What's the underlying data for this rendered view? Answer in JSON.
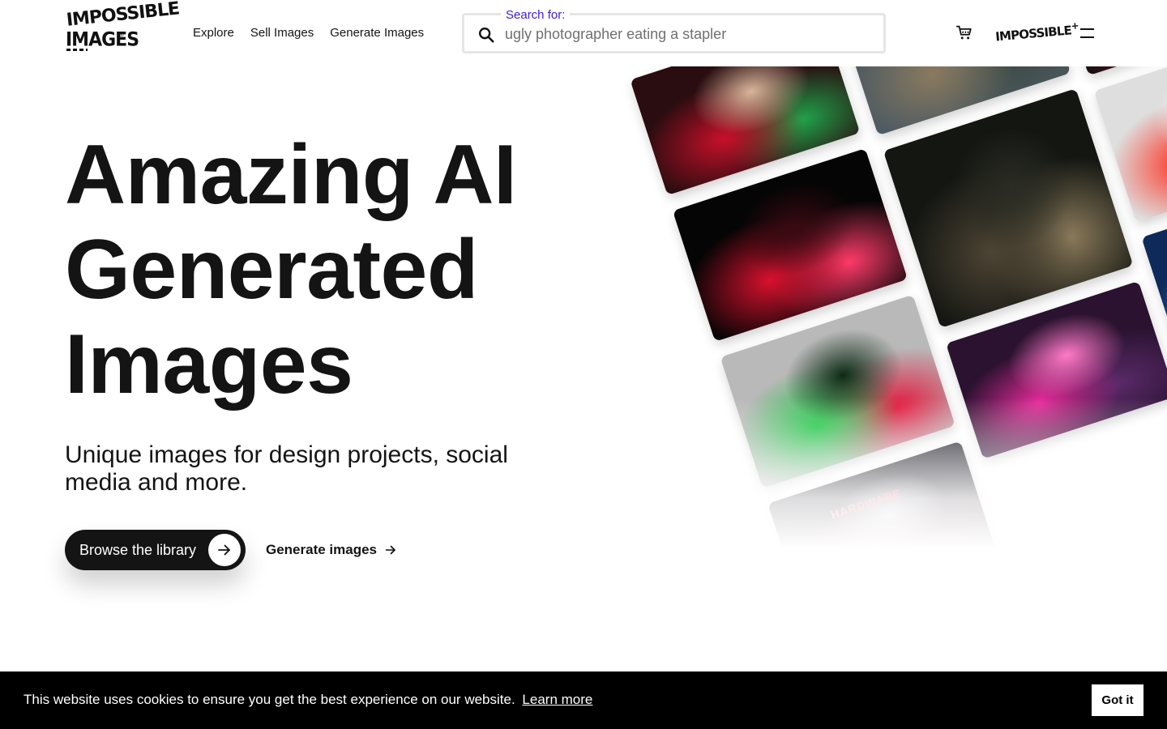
{
  "header": {
    "logo_line1": "IMPOSSIBLE",
    "logo_line2": "IMAGES",
    "logo_reg": "®",
    "nav": [
      "Explore",
      "Sell Images",
      "Generate Images"
    ],
    "search": {
      "legend": "Search for:",
      "placeholder": "ugly photographer eating a stapler"
    },
    "plus_logo": "IMPOSSIBLE",
    "plus_sign": "+"
  },
  "hero": {
    "title_lines": [
      "Amazing AI",
      "Generated",
      "Images"
    ],
    "subtitle": "Unique images for design projects, social media and more.",
    "browse_label": "Browse the library",
    "generate_label": "Generate images"
  },
  "collage": {
    "tiles": [
      {
        "name": "woman-red-green-armor-image",
        "colors": [
          "#2a0d10",
          "#c7102a",
          "#1fa34a",
          "#d9b59a"
        ]
      },
      {
        "name": "monsters-bar-man-image",
        "colors": [
          "#4d5a62",
          "#8a7a5e",
          "#3b4a44",
          "#c9b79a"
        ]
      },
      {
        "name": "woman-red-leather-image",
        "colors": [
          "#1a1012",
          "#e3163d",
          "#5a0a14",
          "#a9b0b5"
        ]
      },
      {
        "name": "man-red-armor-dark-image",
        "colors": [
          "#050505",
          "#d8112e",
          "#ff3b6a",
          "#3a0a12"
        ]
      },
      {
        "name": "giraffe-jungle-image",
        "colors": [
          "#141612",
          "#4d4434",
          "#8a7a5a",
          "#2b2d24"
        ]
      },
      {
        "name": "running-woman-red-image",
        "colors": [
          "#dedede",
          "#ff2a1a",
          "#c01515",
          "#f2f2f2"
        ]
      },
      {
        "name": "man-green-armor-image",
        "colors": [
          "#b9b9b9",
          "#10c43a",
          "#e3143a",
          "#0d2a14"
        ]
      },
      {
        "name": "neon-rain-figure-image",
        "colors": [
          "#2a1230",
          "#e62b9a",
          "#5a2a6a",
          "#ff7ac8"
        ]
      },
      {
        "name": "neon-blue-street-image",
        "colors": [
          "#0e2a5a",
          "#3a7ad8",
          "#b24ab8",
          "#08143a"
        ]
      },
      {
        "name": "hardware-neon-sign-image",
        "colors": [
          "#1a1a24",
          "#e0223a",
          "#6a2a3a",
          "#c9c9d4"
        ],
        "sign_text": "HARDWARE"
      }
    ]
  },
  "cookie": {
    "message": "This website uses cookies to ensure you get the best experience on our website.",
    "learn_more": "Learn more",
    "accept": "Got it"
  }
}
